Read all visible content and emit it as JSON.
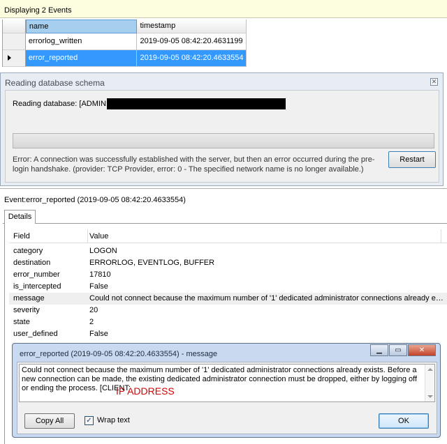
{
  "events_panel": {
    "title": "Displaying 2 Events",
    "columns": [
      "name",
      "timestamp"
    ],
    "rows": [
      {
        "name": "errorlog_written",
        "timestamp": "2019-09-05 08:42:20.4631199",
        "selected": false
      },
      {
        "name": "error_reported",
        "timestamp": "2019-09-05 08:42:20.4633554",
        "selected": true
      }
    ]
  },
  "schema_dialog": {
    "title": "Reading database schema",
    "reading_label": "Reading database: [ADMIN:",
    "progress_fraction": 0,
    "error_text": "Error: A connection was successfully established with the server, but then an error occurred during the pre-login handshake. (provider: TCP Provider, error: 0 - The specified network name is no longer available.)",
    "restart_label": "Restart"
  },
  "event_details": {
    "title": "Event:error_reported (2019-09-05 08:42:20.4633554)",
    "tab_label": "Details",
    "headers": {
      "field": "Field",
      "value": "Value"
    },
    "properties": [
      {
        "field": "category",
        "value": "LOGON"
      },
      {
        "field": "destination",
        "value": "ERRORLOG, EVENTLOG, BUFFER"
      },
      {
        "field": "error_number",
        "value": "17810"
      },
      {
        "field": "is_intercepted",
        "value": "False"
      },
      {
        "field": "message",
        "value": "Could not connect because the maximum number of '1' dedicated administrator connections already exist..."
      },
      {
        "field": "severity",
        "value": "20"
      },
      {
        "field": "state",
        "value": "2"
      },
      {
        "field": "user_defined",
        "value": "False"
      }
    ]
  },
  "message_dialog": {
    "title": "error_reported (2019-09-05 08:42:20.4633554) - message",
    "message_text": "Could not connect because the maximum number of '1' dedicated administrator connections already exists. Before a new connection can be made, the existing dedicated administrator connection must be dropped, either by logging off or ending the process. [CLIENT:",
    "ip_annotation": "IP ADDRESS",
    "copy_all_label": "Copy All",
    "wrap_text_label": "Wrap text",
    "wrap_text_checked": true,
    "ok_label": "OK"
  },
  "colors": {
    "selection": "#3399ff",
    "progress": "#06b025",
    "annotation": "#d40000"
  }
}
